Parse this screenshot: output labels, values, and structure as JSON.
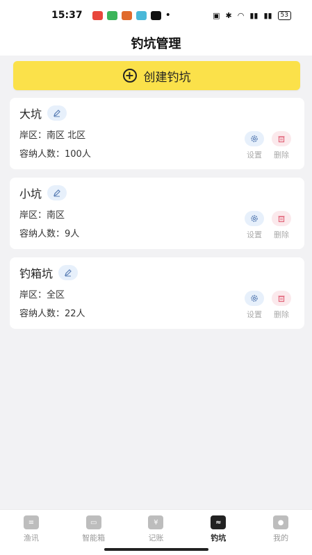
{
  "status": {
    "time": "15:37",
    "dot": "•",
    "battery": "53",
    "icons": [
      "nfc-icon",
      "bluetooth-icon",
      "wifi-icon",
      "signal-icon",
      "signal-icon"
    ]
  },
  "header": {
    "title": "钓坑管理"
  },
  "create_button": {
    "label": "创建钓坑",
    "icon": "plus-circle-icon"
  },
  "ponds": [
    {
      "name": "大坑",
      "shore_label": "岸区：",
      "shore_value": "南区 北区",
      "capacity_label": "容纳人数：",
      "capacity_value": "100人"
    },
    {
      "name": "小坑",
      "shore_label": "岸区：",
      "shore_value": "南区",
      "capacity_label": "容纳人数：",
      "capacity_value": "9人"
    },
    {
      "name": "钓箱坑",
      "shore_label": "岸区：",
      "shore_value": "全区",
      "capacity_label": "容纳人数：",
      "capacity_value": "22人"
    }
  ],
  "actions": {
    "settings_label": "设置",
    "delete_label": "删除"
  },
  "colors": {
    "accent": "#fbe14a",
    "settings_bg": "#e7f0fb",
    "delete_bg": "#fbe9ec",
    "delete_icon": "#e2657a",
    "settings_icon": "#5b7fb5"
  },
  "tabs": [
    {
      "label": "渔讯",
      "icon": "news-icon",
      "active": false
    },
    {
      "label": "智能箱",
      "icon": "box-icon",
      "active": false
    },
    {
      "label": "记账",
      "icon": "ledger-icon",
      "active": false
    },
    {
      "label": "钓坑",
      "icon": "waves-icon",
      "active": true
    },
    {
      "label": "我的",
      "icon": "profile-icon",
      "active": false
    }
  ]
}
